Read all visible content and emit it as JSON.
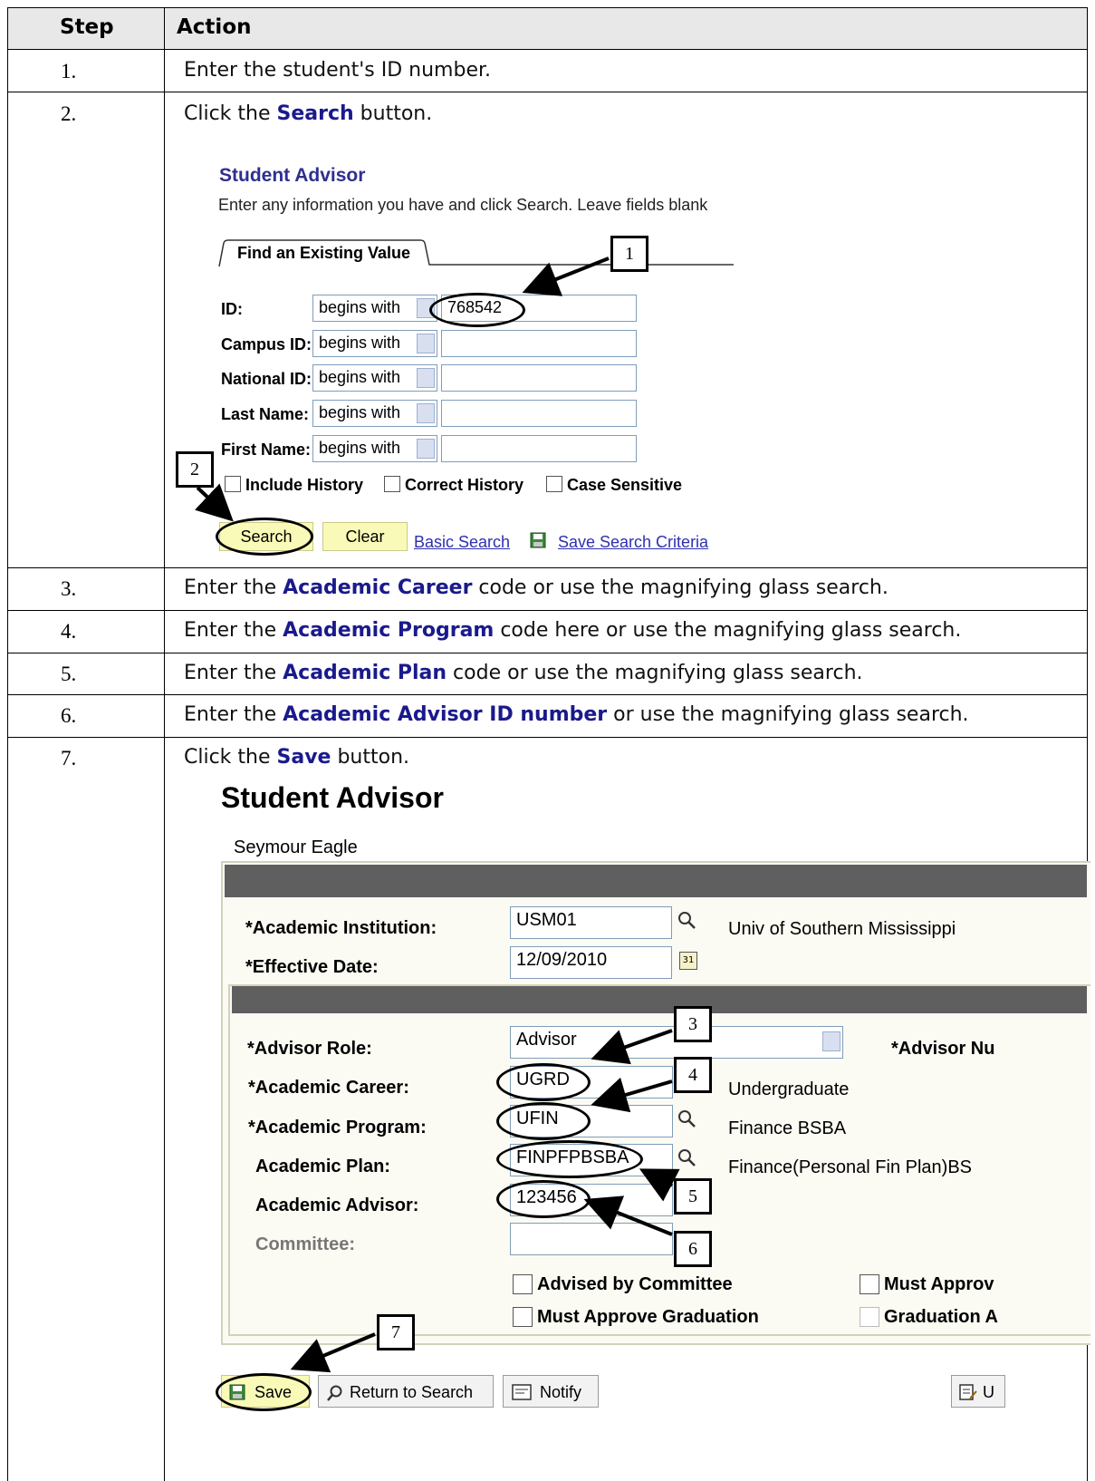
{
  "table": {
    "col_step": "Step",
    "col_action": "Action",
    "rows": [
      {
        "step": "1.",
        "pre": "Enter the student's ID number.",
        "bold": "",
        "post": ""
      },
      {
        "step": "2.",
        "pre": "Click the ",
        "bold": "Search",
        "post": " button."
      },
      {
        "step": "3.",
        "pre": "Enter the ",
        "bold": "Academic Career",
        "post": " code or use the magnifying glass search."
      },
      {
        "step": "4.",
        "pre": "Enter the ",
        "bold": "Academic Program",
        "post": " code here or use the magnifying glass search."
      },
      {
        "step": "5.",
        "pre": "Enter the ",
        "bold": "Academic Plan",
        "post": " code or use the magnifying glass search."
      },
      {
        "step": "6.",
        "pre": "Enter the ",
        "bold": "Academic Advisor ID number",
        "post": " or use the magnifying glass search."
      },
      {
        "step": "7.",
        "pre": "Click the ",
        "bold": "Save",
        "post": " button."
      }
    ]
  },
  "search_page": {
    "title": "Student Advisor",
    "instructions": "Enter any information you have and click Search. Leave fields blank",
    "tab": "Find an Existing Value",
    "operator": "begins with",
    "fields": [
      {
        "label": "ID:",
        "value": "768542"
      },
      {
        "label": "Campus ID:",
        "value": ""
      },
      {
        "label": "National ID:",
        "value": ""
      },
      {
        "label": "Last Name:",
        "value": ""
      },
      {
        "label": "First Name:",
        "value": ""
      }
    ],
    "checkboxes": [
      "Include History",
      "Correct History",
      "Case Sensitive"
    ],
    "search_button": "Search",
    "clear_button": "Clear",
    "basic_search": "Basic Search",
    "save_criteria": "Save Search Criteria"
  },
  "advisor_page": {
    "title": "Student Advisor",
    "student_name": "Seymour Eagle",
    "institution_label": "*Academic Institution:",
    "institution_value": "USM01",
    "institution_desc": "Univ of Southern Mississippi",
    "effdate_label": "*Effective Date:",
    "effdate_value": "12/09/2010",
    "calendar_glyph": "31",
    "role_label": "*Advisor Role:",
    "role_value": "Advisor",
    "advisor_num_label": "*Advisor Nu",
    "career_label": "*Academic Career:",
    "career_value": "UGRD",
    "career_desc": "Undergraduate",
    "program_label": "*Academic Program:",
    "program_value": "UFIN",
    "program_desc": "Finance BSBA",
    "plan_label": "Academic Plan:",
    "plan_value": "FINPFPBSBA",
    "plan_desc": "Finance(Personal Fin Plan)BS",
    "advisor_label": "Academic Advisor:",
    "advisor_value": "123456",
    "committee_label": "Committee:",
    "chk_advised": "Advised by Committee",
    "chk_must_grad": "Must Approve Graduation",
    "chk_must_approve": "Must Approv",
    "chk_grad_a": "Graduation A",
    "save_button": "Save",
    "return_button": "Return to Search",
    "notify_button": "Notify",
    "update_button": "U"
  },
  "callouts": [
    "1",
    "2",
    "3",
    "4",
    "5",
    "6",
    "7"
  ]
}
